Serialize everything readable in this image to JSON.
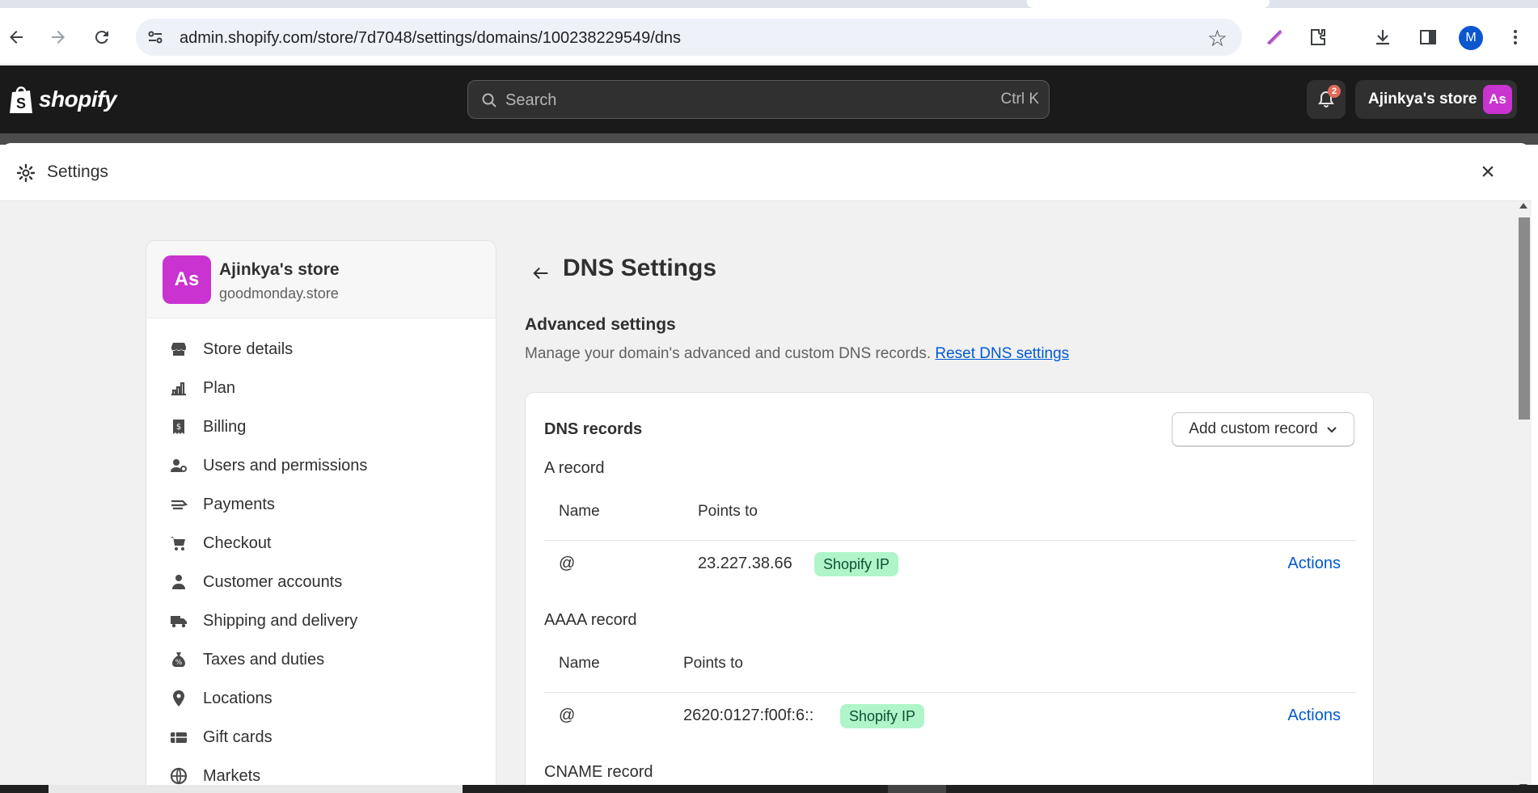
{
  "browser": {
    "url": "admin.shopify.com/store/7d7048/settings/domains/100238229549/dns",
    "profile_initial": "M"
  },
  "topbar": {
    "logo_text": "shopify",
    "search_placeholder": "Search",
    "search_shortcut": "Ctrl K",
    "notification_count": "2",
    "store_name": "Ajinkya's store",
    "store_initials": "As"
  },
  "modal": {
    "title": "Settings"
  },
  "sidebar": {
    "store_name": "Ajinkya's store",
    "store_domain": "goodmonday.store",
    "store_initials": "As",
    "items": [
      {
        "label": "Store details",
        "icon": "store-icon"
      },
      {
        "label": "Plan",
        "icon": "plan-icon"
      },
      {
        "label": "Billing",
        "icon": "billing-icon"
      },
      {
        "label": "Users and permissions",
        "icon": "users-icon"
      },
      {
        "label": "Payments",
        "icon": "payments-icon"
      },
      {
        "label": "Checkout",
        "icon": "cart-icon"
      },
      {
        "label": "Customer accounts",
        "icon": "person-icon"
      },
      {
        "label": "Shipping and delivery",
        "icon": "truck-icon"
      },
      {
        "label": "Taxes and duties",
        "icon": "tax-icon"
      },
      {
        "label": "Locations",
        "icon": "location-icon"
      },
      {
        "label": "Gift cards",
        "icon": "gift-card-icon"
      },
      {
        "label": "Markets",
        "icon": "globe-icon"
      }
    ]
  },
  "main": {
    "page_title": "DNS Settings",
    "advanced_title": "Advanced settings",
    "advanced_desc": "Manage your domain's advanced and custom DNS records.",
    "reset_link": "Reset DNS settings",
    "card_title": "DNS records",
    "add_button": "Add custom record",
    "a_record": {
      "title": "A record",
      "col_name": "Name",
      "col_points": "Points to",
      "name": "@",
      "points_to": "23.227.38.66",
      "badge": "Shopify IP",
      "action": "Actions"
    },
    "aaaa_record": {
      "title": "AAAA record",
      "col_name": "Name",
      "col_points": "Points to",
      "name": "@",
      "points_to": "2620:0127:f00f:6::",
      "badge": "Shopify IP",
      "action": "Actions"
    },
    "cname_title": "CNAME record"
  }
}
